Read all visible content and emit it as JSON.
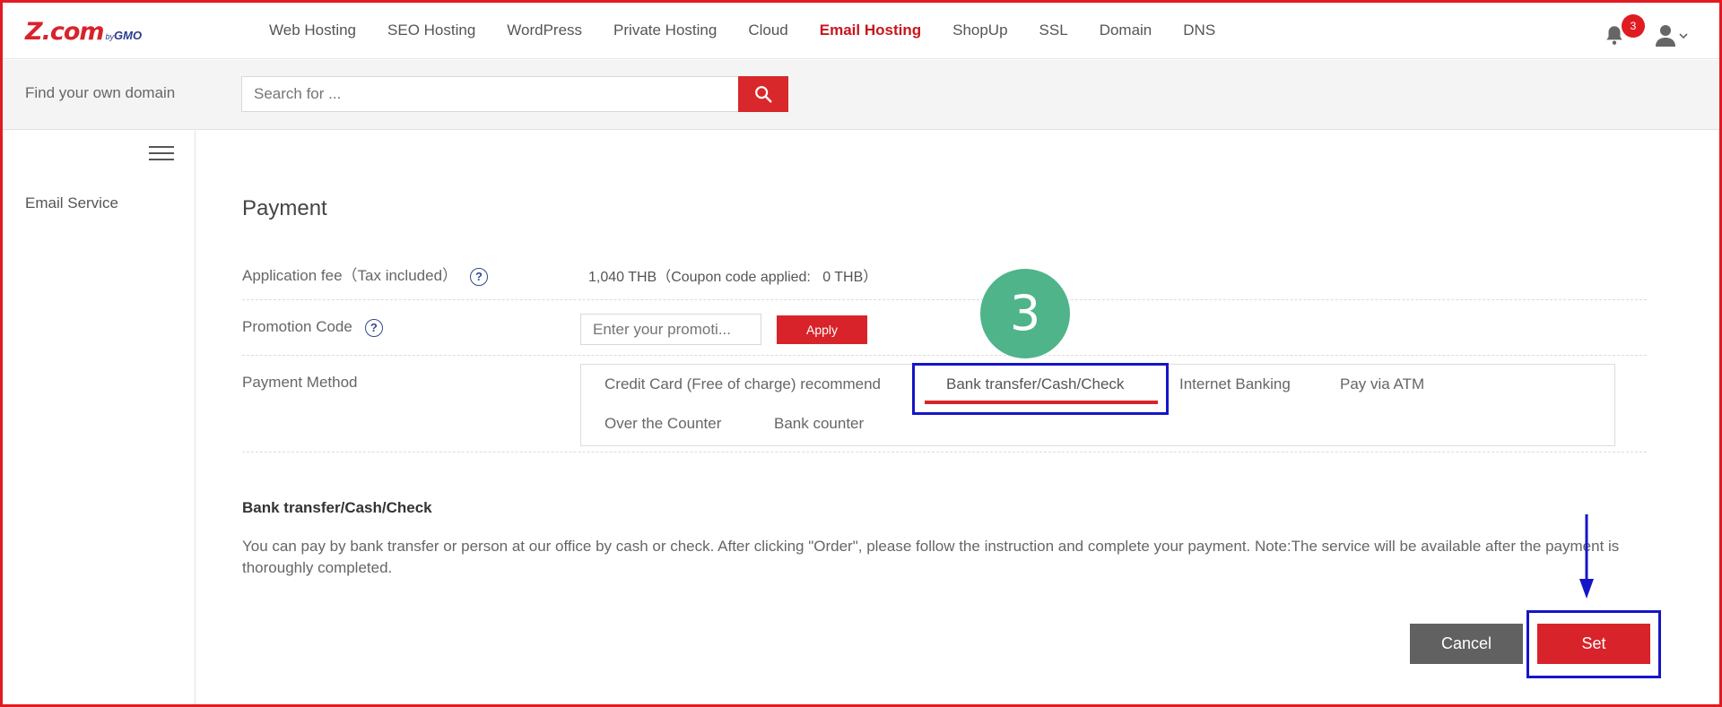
{
  "logo": {
    "main": "Z.com",
    "by": "by",
    "gmo": "GMO"
  },
  "nav": {
    "items": [
      {
        "label": "Web Hosting",
        "active": false
      },
      {
        "label": "SEO Hosting",
        "active": false
      },
      {
        "label": "WordPress",
        "active": false
      },
      {
        "label": "Private Hosting",
        "active": false
      },
      {
        "label": "Cloud",
        "active": false
      },
      {
        "label": "Email Hosting",
        "active": true
      },
      {
        "label": "ShopUp",
        "active": false
      },
      {
        "label": "SSL",
        "active": false
      },
      {
        "label": "Domain",
        "active": false
      },
      {
        "label": "DNS",
        "active": false
      }
    ],
    "notification_count": "3"
  },
  "search": {
    "label": "Find your own domain",
    "placeholder": "Search for ..."
  },
  "sidebar": {
    "items": [
      {
        "label": "Email Service"
      }
    ]
  },
  "payment": {
    "title": "Payment",
    "fee_label": "Application fee（Tax included）",
    "fee_value": "1,040 THB（Coupon code applied:   0 THB）",
    "promo_label": "Promotion Code",
    "promo_placeholder": "Enter your promoti...",
    "apply_label": "Apply",
    "method_label": "Payment Method",
    "methods": [
      {
        "label": "Credit Card (Free of charge) recommend",
        "selected": false
      },
      {
        "label": "Bank transfer/Cash/Check",
        "selected": true
      },
      {
        "label": "Internet Banking",
        "selected": false
      },
      {
        "label": "Pay via ATM",
        "selected": false
      },
      {
        "label": "Over the Counter",
        "selected": false
      },
      {
        "label": "Bank counter",
        "selected": false
      }
    ],
    "selected_heading": "Bank transfer/Cash/Check",
    "selected_description": "You can pay by bank transfer or person at our office by cash or check. After clicking \"Order\", please follow the instruction and complete your payment. Note:The service will be available after the payment is thoroughly completed."
  },
  "annotation": {
    "step": "3"
  },
  "actions": {
    "cancel_label": "Cancel",
    "set_label": "Set"
  },
  "colors": {
    "accent": "#d8232a",
    "highlight": "#1515c8",
    "step_badge": "#4fb489",
    "cancel": "#616161"
  }
}
